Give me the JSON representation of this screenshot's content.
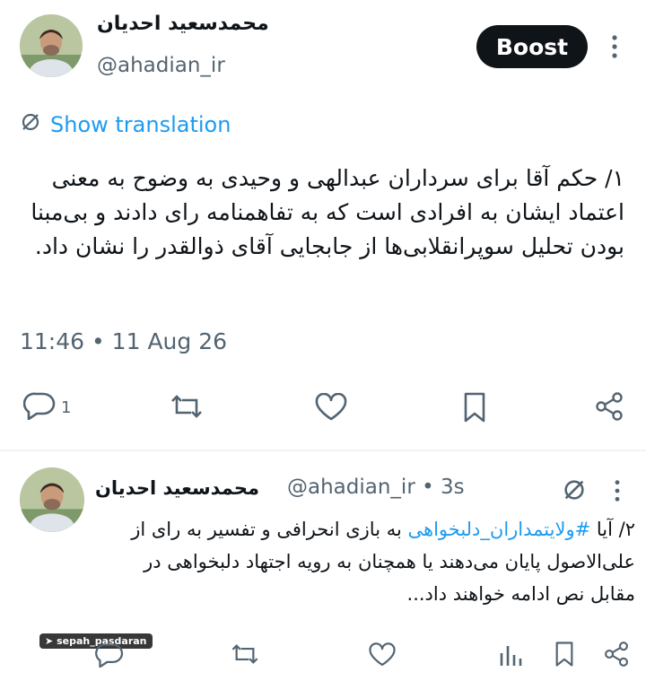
{
  "main_tweet": {
    "author_name": "محمدسعید احدیان",
    "handle": "@ahadian_ir",
    "boost_label": "Boost",
    "translate_label": "Show translation",
    "text": "۱/ حکم آقا برای سرداران عبدالهی و وحیدی به وضوح به معنی اعتماد ایشان به افرادی است که به تفاهمنامه رای دادند و بی‌مبنا بودن تحلیل سوپرانقلابی‌ها از جابجایی آقای ذوالقدر را نشان داد.",
    "timestamp": "11:46 • 11 Aug 26",
    "reply_count": "1"
  },
  "reply_tweet": {
    "author_name": "محمدسعید احدیان",
    "handle_time": "@ahadian_ir • 3s",
    "text_prefix": "۲/ آیا ",
    "hashtag": "#ولایتمداران_دلبخواهی",
    "text_suffix": " به بازی انحرافی و تفسیر به رای از علی‌الاصول پایان می‌دهند یا همچنان به رویه اجتهاد دلبخواهی در مقابل نص ادامه خواهند داد..."
  },
  "watermark": "sepah_pasdaran",
  "colors": {
    "accent": "#1d9bf0",
    "text": "#0f1419",
    "muted": "#536471"
  }
}
